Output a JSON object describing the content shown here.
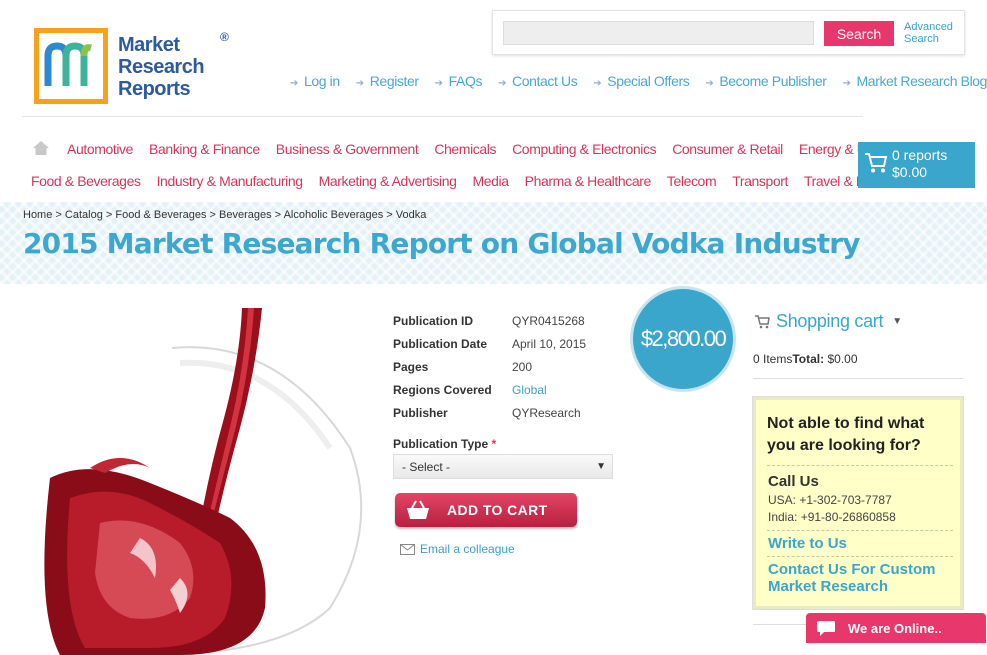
{
  "logo": {
    "lines": [
      "Market",
      "Research",
      "Reports"
    ],
    "reg": "®"
  },
  "search": {
    "placeholder": "",
    "button": "Search",
    "advanced": [
      "Advanced",
      "Search"
    ]
  },
  "topnav": [
    "Log in",
    "Register",
    "FAQs",
    "Contact Us",
    "Special Offers",
    "Become Publisher",
    "Market Research Blog"
  ],
  "categories": {
    "row1": [
      "Automotive",
      "Banking & Finance",
      "Business & Government",
      "Chemicals",
      "Computing & Electronics",
      "Consumer & Retail",
      "Energy & Utilities"
    ],
    "row2": [
      "Food & Beverages",
      "Industry & Manufacturing",
      "Marketing & Advertising",
      "Media",
      "Pharma & Healthcare",
      "Telecom",
      "Transport",
      "Travel & Leisure"
    ]
  },
  "cart": {
    "reports": "0 reports",
    "total": "$0.00"
  },
  "breadcrumb": [
    "Home",
    "Catalog",
    "Food & Beverages",
    "Beverages",
    "Alcoholic Beverages",
    "Vodka"
  ],
  "title": "2015 Market Research Report on Global Vodka Industry",
  "details": [
    {
      "label": "Publication ID",
      "value": "QYR0415268"
    },
    {
      "label": "Publication Date",
      "value": "April 10, 2015"
    },
    {
      "label": "Pages",
      "value": "200"
    },
    {
      "label": "Regions Covered",
      "value": "Global"
    },
    {
      "label": "Publisher",
      "value": "QYResearch"
    }
  ],
  "price": "$2,800.00",
  "publication_type": {
    "label": "Publication Type",
    "required": "*",
    "selected": "- Select -"
  },
  "add_to_cart": "ADD TO CART",
  "email_colleague": "Email a colleague",
  "shopping_cart": {
    "title": "Shopping cart",
    "items": "0 Items",
    "total_label": "Total:",
    "total": "$0.00"
  },
  "help": {
    "question": "Not able to find what you are looking for?",
    "call_us": "Call Us",
    "phone_usa": "USA: +1-302-703-7787",
    "phone_india": "India: +91-80-26860858",
    "write": "Write to Us",
    "custom": "Contact Us For Custom Market Research"
  },
  "chat": "We are Online..",
  "colors": {
    "accent_pink": "#e8376a",
    "accent_blue": "#3aa6cc",
    "logo_orange": "#f7a21b"
  }
}
